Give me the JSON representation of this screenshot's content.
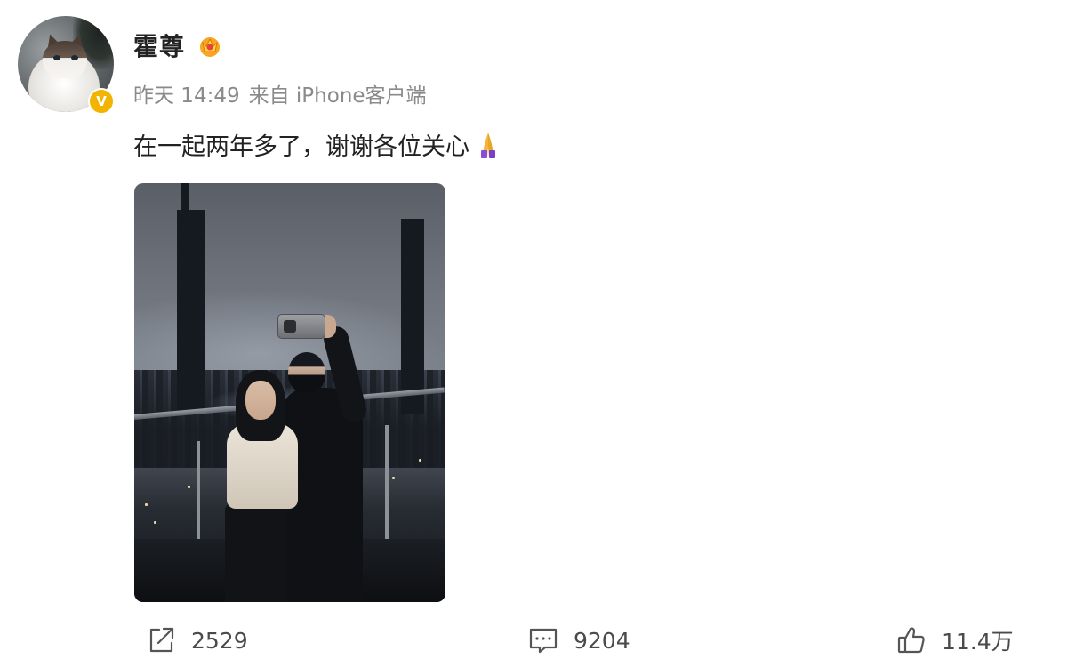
{
  "post": {
    "author": {
      "name": "霍尊",
      "avatar_icon": "cat-avatar",
      "verified_icon": "verified-v-badge-icon",
      "verified_mark": "V",
      "member_badge_icon": "crown-vip-badge-icon"
    },
    "meta": {
      "time": "昨天 14:49",
      "source": "来自 iPhone客户端"
    },
    "text": "在一起两年多了，谢谢各位关心",
    "emoji_icon": "praying-hands-icon",
    "photo_alt": "selfie-photo"
  },
  "actions": {
    "repost": {
      "icon": "share-icon",
      "count": "2529"
    },
    "comment": {
      "icon": "comment-icon",
      "count": "9204"
    },
    "like": {
      "icon": "thumbs-up-icon",
      "count": "11.4万"
    }
  },
  "colors": {
    "verified": "#f3b400",
    "meta_text": "#8a8a8a",
    "body_text": "#222222",
    "emoji": "#8a4fd0"
  }
}
